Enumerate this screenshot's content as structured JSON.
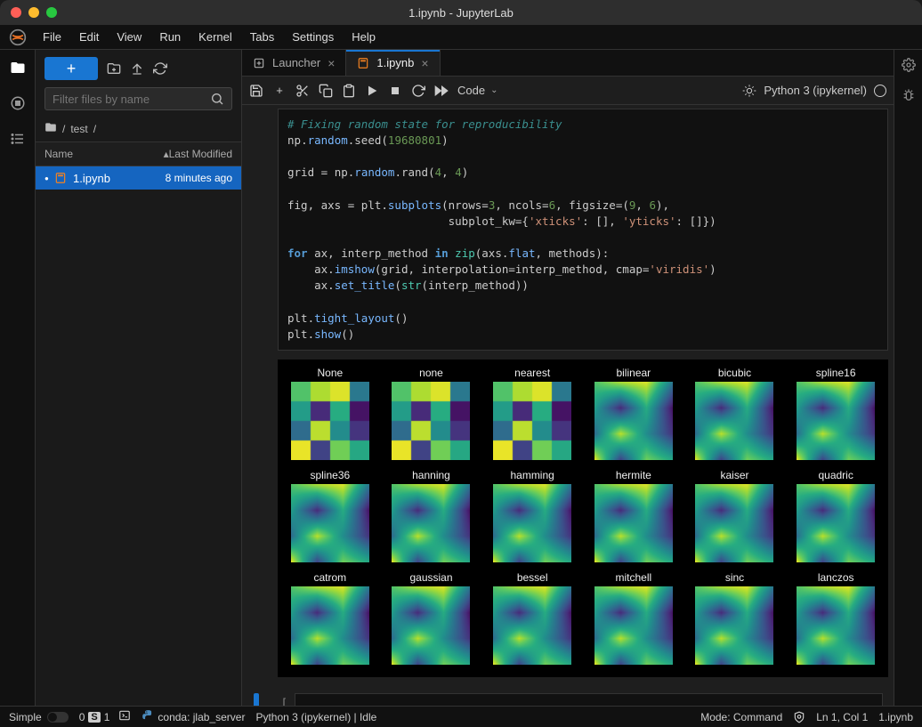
{
  "window": {
    "title": "1.ipynb - JupyterLab"
  },
  "menubar": [
    "File",
    "Edit",
    "View",
    "Run",
    "Kernel",
    "Tabs",
    "Settings",
    "Help"
  ],
  "filebrowser": {
    "filter_placeholder": "Filter files by name",
    "breadcrumb_seg": "test",
    "columns": {
      "name": "Name",
      "modified": "Last Modified"
    },
    "files": [
      {
        "name": "1.ipynb",
        "modified": "8 minutes ago",
        "selected": true
      }
    ]
  },
  "tabs": [
    {
      "label": "Launcher",
      "active": false,
      "icon": "plus-square"
    },
    {
      "label": "1.ipynb",
      "active": true,
      "icon": "notebook"
    }
  ],
  "notebook_toolbar": {
    "cell_type": "Code",
    "kernel_name": "Python 3 (ipykernel)"
  },
  "code_lines": [
    {
      "t": "comment",
      "s": "# Fixing random state for reproducibility"
    },
    {
      "t": "line",
      "parts": [
        {
          "c": "ident",
          "s": "np"
        },
        {
          "c": "p",
          "s": "."
        },
        {
          "c": "attr",
          "s": "random"
        },
        {
          "c": "p",
          "s": "."
        },
        {
          "c": "ident",
          "s": "seed"
        },
        {
          "c": "p",
          "s": "("
        },
        {
          "c": "num",
          "s": "19680801"
        },
        {
          "c": "p",
          "s": ")"
        }
      ]
    },
    {
      "t": "blank"
    },
    {
      "t": "line",
      "parts": [
        {
          "c": "ident",
          "s": "grid "
        },
        {
          "c": "op",
          "s": "= "
        },
        {
          "c": "ident",
          "s": "np"
        },
        {
          "c": "p",
          "s": "."
        },
        {
          "c": "attr",
          "s": "random"
        },
        {
          "c": "p",
          "s": "."
        },
        {
          "c": "ident",
          "s": "rand"
        },
        {
          "c": "p",
          "s": "("
        },
        {
          "c": "num",
          "s": "4"
        },
        {
          "c": "p",
          "s": ", "
        },
        {
          "c": "num",
          "s": "4"
        },
        {
          "c": "p",
          "s": ")"
        }
      ]
    },
    {
      "t": "blank"
    },
    {
      "t": "line",
      "parts": [
        {
          "c": "ident",
          "s": "fig, axs "
        },
        {
          "c": "op",
          "s": "= "
        },
        {
          "c": "ident",
          "s": "plt"
        },
        {
          "c": "p",
          "s": "."
        },
        {
          "c": "attr",
          "s": "subplots"
        },
        {
          "c": "p",
          "s": "(nrows"
        },
        {
          "c": "op",
          "s": "="
        },
        {
          "c": "num",
          "s": "3"
        },
        {
          "c": "p",
          "s": ", ncols"
        },
        {
          "c": "op",
          "s": "="
        },
        {
          "c": "num",
          "s": "6"
        },
        {
          "c": "p",
          "s": ", figsize"
        },
        {
          "c": "op",
          "s": "="
        },
        {
          "c": "p",
          "s": "("
        },
        {
          "c": "num",
          "s": "9"
        },
        {
          "c": "p",
          "s": ", "
        },
        {
          "c": "num",
          "s": "6"
        },
        {
          "c": "p",
          "s": "),"
        }
      ]
    },
    {
      "t": "line",
      "parts": [
        {
          "c": "p",
          "s": "                        subplot_kw"
        },
        {
          "c": "op",
          "s": "="
        },
        {
          "c": "p",
          "s": "{"
        },
        {
          "c": "str",
          "s": "'xticks'"
        },
        {
          "c": "p",
          "s": ": [], "
        },
        {
          "c": "str",
          "s": "'yticks'"
        },
        {
          "c": "p",
          "s": ": []})"
        }
      ]
    },
    {
      "t": "blank"
    },
    {
      "t": "line",
      "parts": [
        {
          "c": "kw",
          "s": "for"
        },
        {
          "c": "p",
          "s": " ax, interp_method "
        },
        {
          "c": "kw",
          "s": "in"
        },
        {
          "c": "p",
          "s": " "
        },
        {
          "c": "builtin",
          "s": "zip"
        },
        {
          "c": "p",
          "s": "(axs"
        },
        {
          "c": "p",
          "s": "."
        },
        {
          "c": "attr",
          "s": "flat"
        },
        {
          "c": "p",
          "s": ", methods):"
        }
      ]
    },
    {
      "t": "line",
      "parts": [
        {
          "c": "p",
          "s": "    ax"
        },
        {
          "c": "p",
          "s": "."
        },
        {
          "c": "attr",
          "s": "imshow"
        },
        {
          "c": "p",
          "s": "(grid, interpolation"
        },
        {
          "c": "op",
          "s": "="
        },
        {
          "c": "p",
          "s": "interp_method, cmap"
        },
        {
          "c": "op",
          "s": "="
        },
        {
          "c": "str",
          "s": "'viridis'"
        },
        {
          "c": "p",
          "s": ")"
        }
      ]
    },
    {
      "t": "line",
      "parts": [
        {
          "c": "p",
          "s": "    ax"
        },
        {
          "c": "p",
          "s": "."
        },
        {
          "c": "attr",
          "s": "set_title"
        },
        {
          "c": "p",
          "s": "("
        },
        {
          "c": "builtin",
          "s": "str"
        },
        {
          "c": "p",
          "s": "(interp_method))"
        }
      ]
    },
    {
      "t": "blank"
    },
    {
      "t": "line",
      "parts": [
        {
          "c": "ident",
          "s": "plt"
        },
        {
          "c": "p",
          "s": "."
        },
        {
          "c": "attr",
          "s": "tight_layout"
        },
        {
          "c": "p",
          "s": "()"
        }
      ]
    },
    {
      "t": "line",
      "parts": [
        {
          "c": "ident",
          "s": "plt"
        },
        {
          "c": "p",
          "s": "."
        },
        {
          "c": "attr",
          "s": "show"
        },
        {
          "c": "p",
          "s": "()"
        }
      ]
    }
  ],
  "empty_prompt": "[ ]:",
  "chart_data": {
    "type": "heatmap",
    "layout": {
      "rows": 3,
      "cols": 6
    },
    "cmap": "viridis",
    "viridis_colors": [
      "#440154",
      "#472d7b",
      "#3b528b",
      "#2c728e",
      "#21918c",
      "#27ad81",
      "#5ec962",
      "#aadc32",
      "#fde725"
    ],
    "grid_size": [
      4,
      4
    ],
    "grid_values": [
      [
        0.72,
        0.88,
        0.95,
        0.4
      ],
      [
        0.55,
        0.12,
        0.62,
        0.05
      ],
      [
        0.35,
        0.9,
        0.48,
        0.15
      ],
      [
        0.97,
        0.2,
        0.78,
        0.6
      ]
    ],
    "subplots": [
      {
        "title": "None",
        "interp": "none"
      },
      {
        "title": "none",
        "interp": "none"
      },
      {
        "title": "nearest",
        "interp": "none"
      },
      {
        "title": "bilinear",
        "interp": "smooth"
      },
      {
        "title": "bicubic",
        "interp": "smooth"
      },
      {
        "title": "spline16",
        "interp": "smooth"
      },
      {
        "title": "spline36",
        "interp": "smooth"
      },
      {
        "title": "hanning",
        "interp": "smooth"
      },
      {
        "title": "hamming",
        "interp": "smooth"
      },
      {
        "title": "hermite",
        "interp": "smooth"
      },
      {
        "title": "kaiser",
        "interp": "smooth"
      },
      {
        "title": "quadric",
        "interp": "smooth"
      },
      {
        "title": "catrom",
        "interp": "smooth"
      },
      {
        "title": "gaussian",
        "interp": "smooth"
      },
      {
        "title": "bessel",
        "interp": "smooth"
      },
      {
        "title": "mitchell",
        "interp": "smooth"
      },
      {
        "title": "sinc",
        "interp": "smooth"
      },
      {
        "title": "lanczos",
        "interp": "smooth"
      }
    ]
  },
  "statusbar": {
    "simple_label": "Simple",
    "counter1": "0",
    "counter_badge": "S",
    "counter2": "1",
    "env": "conda: jlab_server",
    "kernel": "Python 3 (ipykernel) | Idle",
    "mode": "Mode: Command",
    "position": "Ln 1, Col 1",
    "filename": "1.ipynb"
  }
}
